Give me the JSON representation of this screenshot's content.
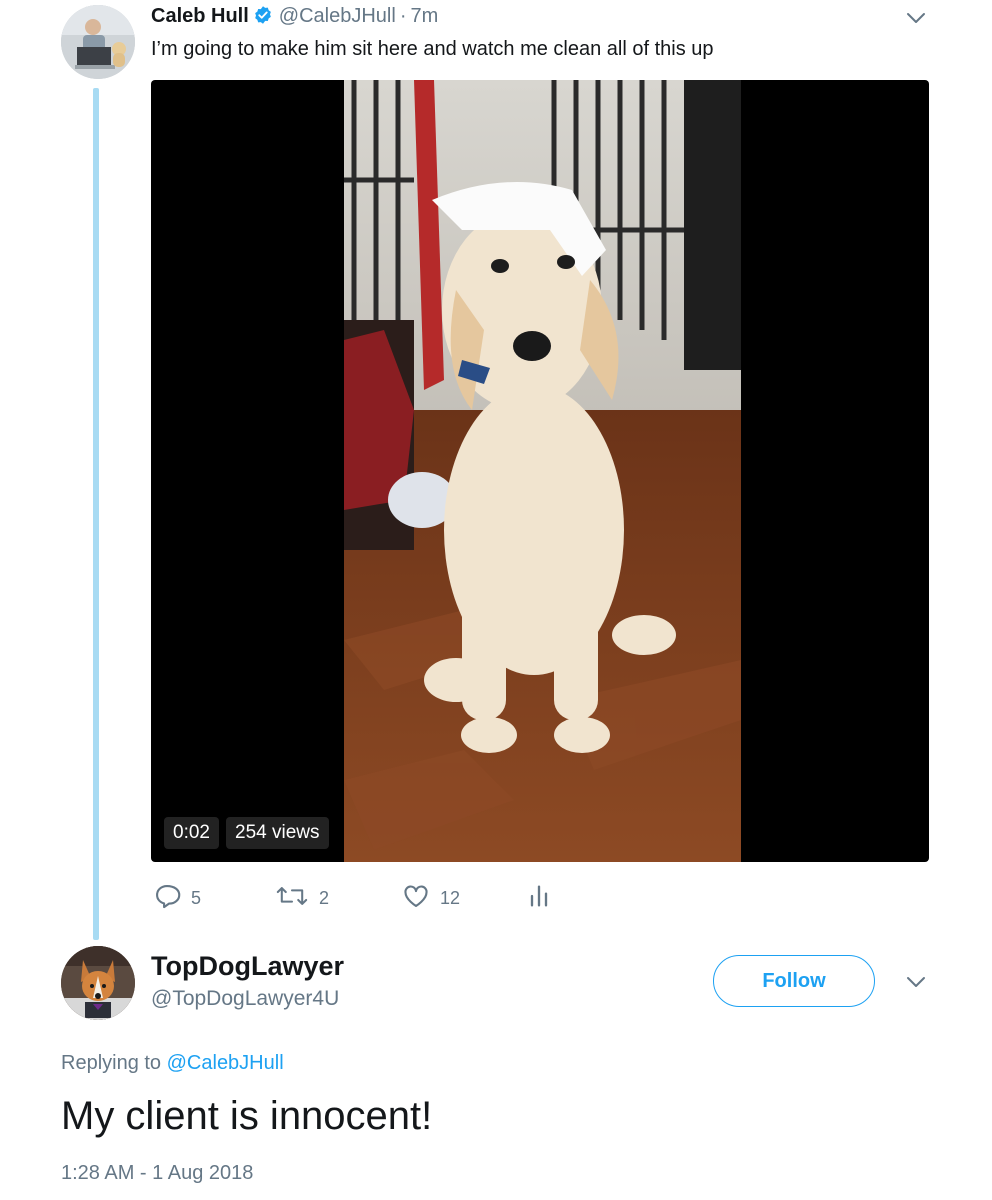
{
  "tweet": {
    "author_name": "Caleb Hull",
    "author_handle": "@CalebJHull",
    "separator": "·",
    "time_ago": "7m",
    "text": "I’m going to make him sit here and watch me clean all of this up",
    "video": {
      "duration": "0:02",
      "views": "254 views"
    },
    "actions": {
      "replies": "5",
      "retweets": "2",
      "likes": "12"
    }
  },
  "reply": {
    "author_name": "TopDogLawyer",
    "author_handle": "@TopDogLawyer4U",
    "follow_label": "Follow",
    "replying_prefix": "Replying to",
    "replying_to": "@CalebJHull",
    "text": "My client is innocent!",
    "timestamp": "1:28 AM - 1 Aug 2018"
  },
  "icons": {
    "verified": "verified-badge-icon",
    "caret": "chevron-down-icon",
    "reply": "reply-icon",
    "retweet": "retweet-icon",
    "like": "heart-icon",
    "analytics": "analytics-icon"
  },
  "colors": {
    "accent": "#1da1f2",
    "thread_line": "#a8dbf3",
    "muted_text": "#657786",
    "primary_text": "#14171a"
  }
}
